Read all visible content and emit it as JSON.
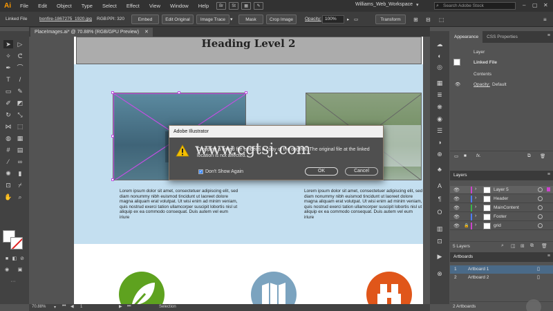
{
  "app": {
    "logo": "Ai",
    "menus": [
      "File",
      "Edit",
      "Object",
      "Type",
      "Select",
      "Effect",
      "View",
      "Window",
      "Help"
    ],
    "bridge_icon": "Br",
    "stock_icon": "St",
    "workspace": "Williams_Web_Workspace",
    "search_placeholder": "Search Adobe Stock"
  },
  "controlbar": {
    "linked_file_label": "Linked File",
    "file_name": "bonfire-1867275_1920.jpg",
    "color_mode": "RGB",
    "ppi": "PPI: 320",
    "embed": "Embed",
    "edit_original": "Edit Original",
    "image_trace": "Image Trace",
    "mask": "Mask",
    "crop_image": "Crop Image",
    "opacity_label": "Opacity:",
    "opacity_value": "100%",
    "transform": "Transform"
  },
  "document": {
    "tab_title": "PlaceImages.ai* @ 70.88% (RGB/GPU Preview)",
    "heading": "Heading Level 2",
    "lorem_left": "Lorem ipsum dolor sit amet, consectetuer adipiscing elit, sed diam nonummy nibh euismod tincidunt ut laoreet dolore magna aliquam erat volutpat. Ut wisi enim ad minim veniam, quis nostrud exerci tation ullamcorper suscipit lobortis nisl ut aliquip ex ea commodo consequat. Duis autem vel eum iriure",
    "lorem_right": "Lorem ipsum dolor sit amet, consectetuer adipiscing elit, sed diam nonummy nibh euismod tincidunt ut laoreet dolore magna aliquam erat volutpat. Ut wisi enim ad minim veniam, quis nostrud exerci tation ullamcorper suscipit lobortis nisl ut aliquip ex ea commodo consequat. Duis autem vel eum iriure"
  },
  "dialog": {
    "title": "Adobe Illustrator",
    "message": "Cropping a linked file embeds a copy of the original. The original file at the linked location is not affected.",
    "dont_show_again": "Don't Show Again",
    "ok": "OK",
    "cancel": "Cancel",
    "watermark": "www.cgtsj.com"
  },
  "appearance": {
    "tabs": [
      "Appearance",
      "CSS Properties"
    ],
    "layer_label": "Layer",
    "linked_file": "Linked File",
    "contents": "Contents",
    "opacity_label": "Opacity:",
    "opacity_value": "Default",
    "fx": "fx."
  },
  "layers": {
    "tab": "Layers",
    "items": [
      {
        "name": "Layer 5",
        "color": "#cc44cc"
      },
      {
        "name": "Header",
        "color": "#4d7dff"
      },
      {
        "name": "MainContent",
        "color": "#3ab54a"
      },
      {
        "name": "Footer",
        "color": "#4d7dff"
      },
      {
        "name": "grid",
        "color": "#cc44cc"
      }
    ],
    "count": "5 Layers"
  },
  "artboards": {
    "tab": "Artboards",
    "items": [
      {
        "num": "1",
        "name": "Artboard 1"
      },
      {
        "num": "2",
        "name": "Artboard 2"
      }
    ],
    "count": "2 Artboards"
  },
  "status": {
    "zoom": "70.88%",
    "artboard_num": "1",
    "tool": "Selection"
  },
  "colors": {
    "accent": "#ff9a00",
    "green_circle": "#5ea21f",
    "blue_circle": "#7ba3bf",
    "orange_circle": "#e0561a",
    "selection": "#c050e0"
  }
}
